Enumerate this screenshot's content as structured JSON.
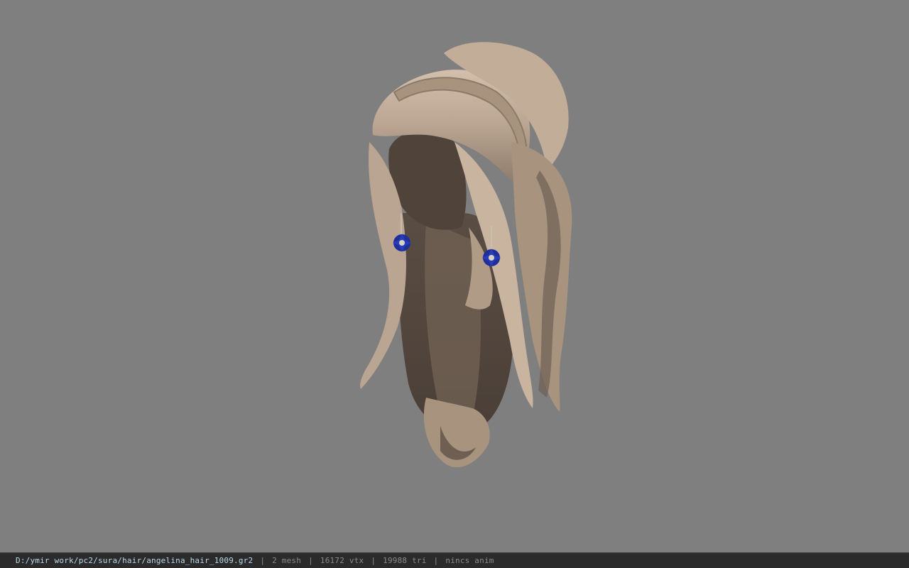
{
  "viewer": {
    "background_color": "#7f7f7f",
    "model": {
      "subject": "hair-model",
      "colors": {
        "hair_light": "#c9b4a0",
        "hair_mid": "#a8937f",
        "hair_shadow": "#6e5f52",
        "scalp_dark": "#4f433a",
        "earring_blue": "#1f2f9a",
        "earring_center": "#d7d2c6"
      }
    }
  },
  "statusbar": {
    "file_path": "D:/ymir work/pc2/sura/hair/angelina_hair_1009.gr2",
    "separator": "|",
    "mesh": "2 mesh",
    "vertices": "16172 vtx",
    "triangles": "19988 tri",
    "anim": "nincs anim",
    "colors": {
      "background": "#2b2b2b",
      "path_text": "#bcd8e8",
      "stat_text": "#8a8a8a"
    }
  }
}
